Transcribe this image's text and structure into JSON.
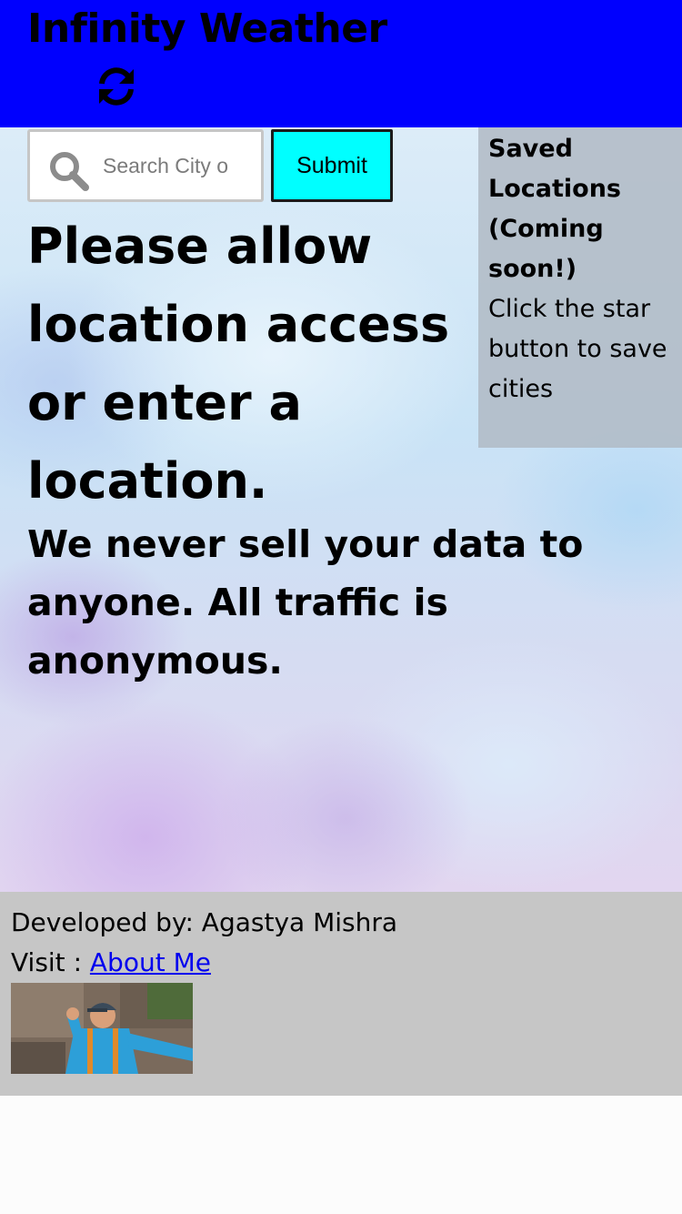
{
  "header": {
    "app_title": "Infinity Weather",
    "refresh_icon": "refresh-icon",
    "background_color": "#0000fe"
  },
  "search": {
    "placeholder": "Search City or Zip",
    "value": "",
    "icon": "search-icon",
    "submit_label": "Submit",
    "submit_color": "#00ffff"
  },
  "main": {
    "prompt_heading": "Please allow location access or enter a location.",
    "privacy_note": "We never sell your data to anyone. All traffic is anonymous."
  },
  "saved_locations": {
    "title": "Saved Locations (Coming soon!)",
    "hint": "Click the star button to save cities"
  },
  "footer": {
    "credit": "Developed by: Agastya Mishra",
    "visit_prefix": "Visit : ",
    "about_link": "About Me",
    "background_color": "#c6c6c6"
  }
}
